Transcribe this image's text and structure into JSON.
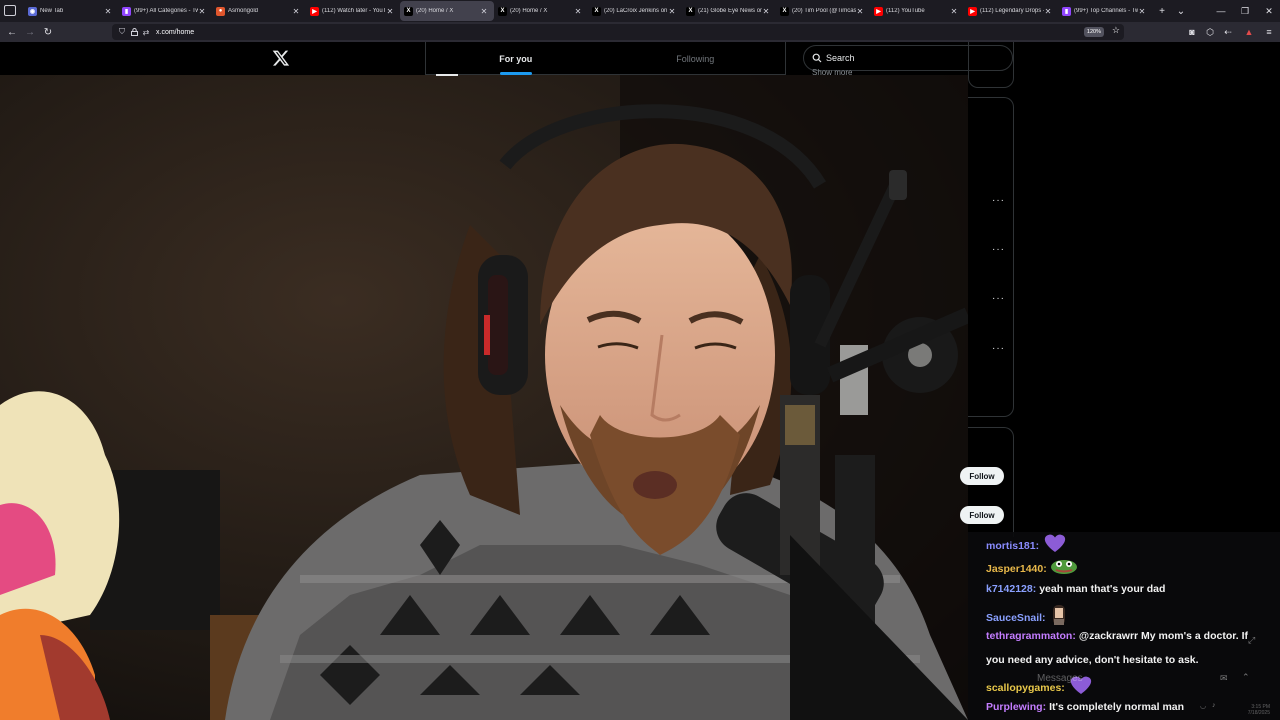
{
  "browser": {
    "tabs": [
      {
        "title": "New Tab",
        "favicon": "firefox-icon",
        "color": "#5b6bd6",
        "active": false
      },
      {
        "title": "(99+) All Categories - Tw",
        "favicon": "twitch-icon",
        "color": "#9146ff",
        "active": false
      },
      {
        "title": "Asmongold",
        "favicon": "channel-icon",
        "color": "#e0562d",
        "active": false
      },
      {
        "title": "(112) Watch later - YouTu",
        "favicon": "youtube-icon",
        "color": "#ff0000",
        "active": false
      },
      {
        "title": "(20) Home / X",
        "favicon": "x-icon",
        "color": "#000000",
        "active": true
      },
      {
        "title": "(20) Home / X",
        "favicon": "x-icon",
        "color": "#000000",
        "active": false
      },
      {
        "title": "(20) LaCroix Jenkins on X",
        "favicon": "x-icon",
        "color": "#000000",
        "active": false
      },
      {
        "title": "(21) Globe Eye News on",
        "favicon": "x-icon",
        "color": "#000000",
        "active": false
      },
      {
        "title": "(20) Tim Pool (@Timcast",
        "favicon": "x-icon",
        "color": "#000000",
        "active": false
      },
      {
        "title": "(112) YouTube",
        "favicon": "youtube-icon",
        "color": "#ff0000",
        "active": false
      },
      {
        "title": "(112) Legendary Drops -",
        "favicon": "youtube-icon",
        "color": "#ff0000",
        "active": false
      },
      {
        "title": "(99+) Top Channels - Tw",
        "favicon": "twitch-icon",
        "color": "#9146ff",
        "active": false
      }
    ],
    "new_tab_symbol": "+",
    "tab_list_symbol": "⌄",
    "minimize_symbol": "—",
    "maximize_symbol": "❐",
    "close_symbol": "✕",
    "url": "x.com/home",
    "zoom": "120%"
  },
  "x": {
    "tabs": [
      {
        "label": "For you",
        "active": true
      },
      {
        "label": "Following",
        "active": false
      }
    ],
    "search_placeholder": "Search",
    "show_more": "Show more",
    "follow_label": "Follow",
    "more_symbol": "···"
  },
  "chat": {
    "messages": [
      {
        "user": "mortis181:",
        "color": "#8a8cff",
        "text": "",
        "emote": "purple-heart-emote"
      },
      {
        "user": "Jasper1440:",
        "color": "#e8b84a",
        "text": "",
        "emote": "pepe-emote"
      },
      {
        "user": "k7142128:",
        "color": "#8aa0ff",
        "text": "yeah man that's your dad",
        "emote": ""
      },
      {
        "user": "SauceSnail:",
        "color": "#8aa0ff",
        "text": "",
        "emote": "pixel-girl-emote"
      },
      {
        "user": "tethragrammaton:",
        "color": "#c47dff",
        "text": "@zackrawrr My mom's a doctor. If",
        "emote": ""
      },
      {
        "user": "",
        "color": "#f2f2f2",
        "text": "you need any advice, don't hesitate to ask.",
        "emote": ""
      },
      {
        "user": "scallopygames:",
        "color": "#e8c84a",
        "text": "",
        "emote": "purple-heart-emote"
      },
      {
        "user": "Purplewing:",
        "color": "#c47dff",
        "text": "It's completely normal man",
        "emote": ""
      }
    ],
    "watermark": "Messages",
    "clock_time": "3:15 PM",
    "clock_date": "7/18/2025"
  }
}
